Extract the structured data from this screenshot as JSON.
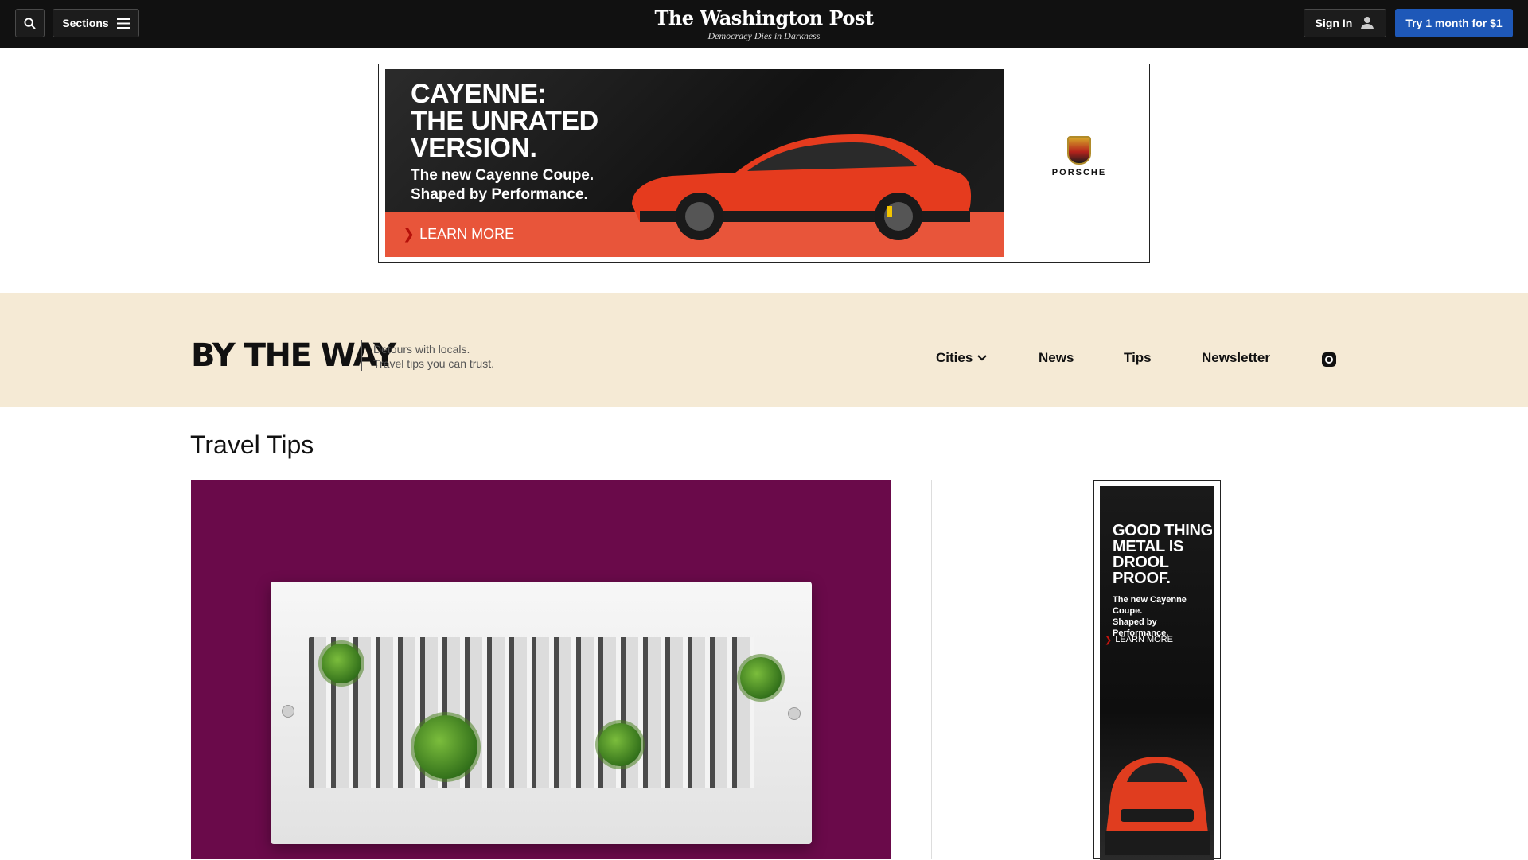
{
  "header": {
    "sections_label": "Sections",
    "masthead": "The Washington Post",
    "tagline": "Democracy Dies in Darkness",
    "signin_label": "Sign In",
    "subscribe_label": "Try 1 month for $1"
  },
  "top_ad": {
    "headline_lines": [
      "CAYENNE:",
      "THE UNRATED",
      "VERSION."
    ],
    "sub_lines": [
      "The new Cayenne Coupe.",
      "Shaped by Performance."
    ],
    "cta": "LEARN MORE",
    "brand": "PORSCHE"
  },
  "section_header": {
    "logo": "BY THE WAY",
    "tagline_lines": [
      "Detours with locals.",
      "Travel tips you can trust."
    ],
    "nav": [
      "Cities",
      "News",
      "Tips",
      "Newsletter"
    ]
  },
  "main": {
    "title": "Travel Tips"
  },
  "side_ad": {
    "headline_lines": [
      "GOOD THING",
      "METAL IS",
      "DROOL",
      "PROOF."
    ],
    "sub_lines": [
      "The new Cayenne Coupe.",
      "Shaped by Performance."
    ],
    "cta": "LEARN MORE"
  },
  "colors": {
    "topbar": "#111111",
    "subscribe": "#1e58b8",
    "band": "#f5ead5",
    "hero_bg": "#6a0a4a",
    "ad_orange": "#e8553a"
  }
}
